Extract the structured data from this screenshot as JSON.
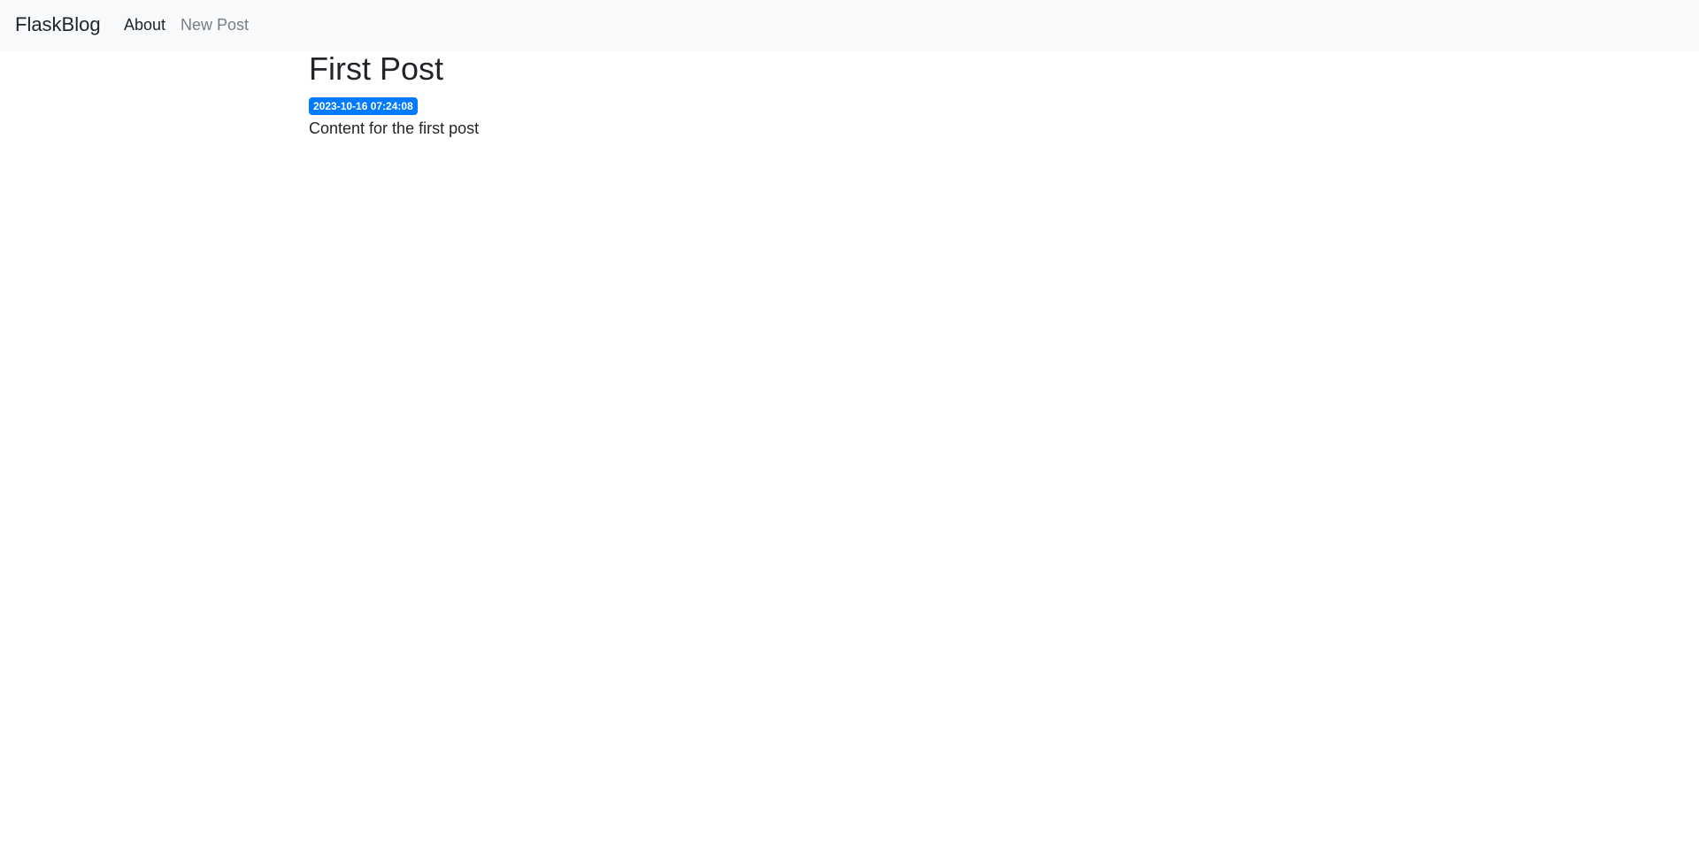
{
  "navbar": {
    "brand": "FlaskBlog",
    "links": [
      {
        "label": "About"
      },
      {
        "label": "New Post"
      }
    ]
  },
  "post": {
    "title": "First Post",
    "timestamp": "2023-10-16 07:24:08",
    "content": "Content for the first post"
  },
  "colors": {
    "navbar_bg": "#f8f9fa",
    "badge_bg": "#007bff",
    "text": "#212529",
    "muted_link": "#7a7d80"
  }
}
